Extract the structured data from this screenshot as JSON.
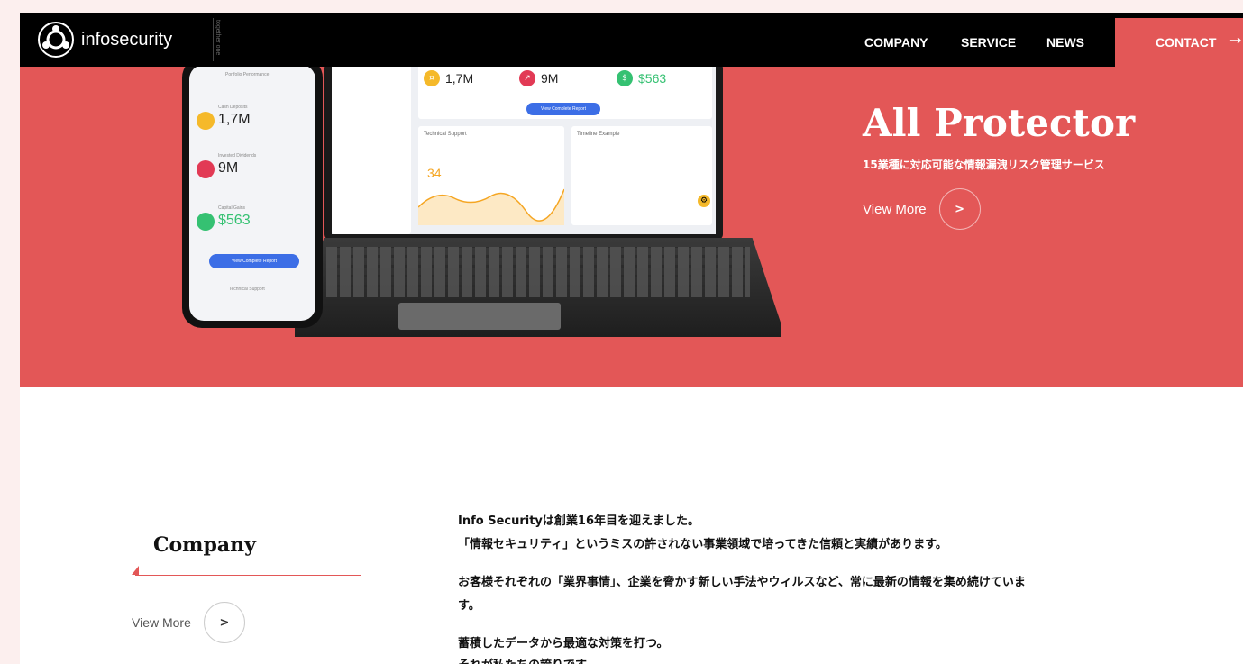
{
  "header": {
    "logo_text": "infosecurity",
    "logo_tagline": "together one",
    "nav": [
      "COMPANY",
      "SERVICE",
      "NEWS"
    ],
    "contact_label": "CONTACT",
    "contact_arrow": "→"
  },
  "hero": {
    "title": "All Protector",
    "subtitle": "15業種に対応可能な情報漏洩リスク管理サービス",
    "more_label": "View More",
    "more_icon": "chevron-right-icon",
    "mock_stats": [
      "1,7M",
      "9M",
      "$563"
    ],
    "mock_chart_value": "34",
    "mock_button": "View Complete Report",
    "mock_panels": [
      "Technical Support",
      "Timeline Example"
    ],
    "phone_labels": [
      "Portfolio Performance",
      "Cash Deposits",
      "Invested Dividends",
      "Capital Gains",
      "Technical Support"
    ],
    "phone_button": "View Complete Report"
  },
  "company": {
    "title": "Company",
    "more_label": "View More",
    "paragraphs": [
      "Info Securityは創業16年目を迎えました。",
      "「情報セキュリティ」というミスの許されない事業領域で培ってきた信頼と実績があります。",
      "お客様それぞれの「業界事情」、企業を脅かす新しい手法やウィルスなど、常に最新の情報を集め続けていま",
      "す。",
      "蓄積したデータから最適な対策を打つ。",
      "それが私たちの誇りです。"
    ]
  },
  "colors": {
    "accent": "#e35757",
    "header_bg": "#000000",
    "page_bg": "#fcefee"
  }
}
